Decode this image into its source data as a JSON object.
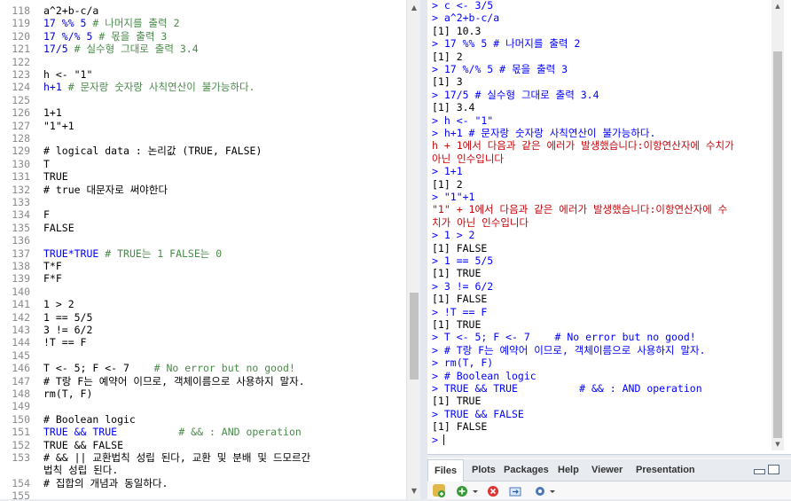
{
  "editor": {
    "lines": [
      {
        "n": "118",
        "t": "a^2+b-c/a",
        "c": "plain"
      },
      {
        "n": "119",
        "t": "17 %% 5 # 나머지를 출력 2",
        "c": "mix1"
      },
      {
        "n": "120",
        "t": "17 %/% 5 # 몫을 출력 3",
        "c": "mix1"
      },
      {
        "n": "121",
        "t": "17/5 # 실수형 그대로 출력 3.4",
        "c": "mix1"
      },
      {
        "n": "122",
        "t": "",
        "c": "plain"
      },
      {
        "n": "123",
        "t": "h <- \"1\"",
        "c": "plain"
      },
      {
        "n": "124",
        "t": "h+1 # 문자랑 숫자랑 사칙연산이 불가능하다.",
        "c": "mix1"
      },
      {
        "n": "125",
        "t": "",
        "c": "plain"
      },
      {
        "n": "126",
        "t": "1+1",
        "c": "num"
      },
      {
        "n": "127",
        "t": "\"1\"+1",
        "c": "plain"
      },
      {
        "n": "128",
        "t": "",
        "c": "plain"
      },
      {
        "n": "129",
        "t": "# logical data : 논리값 (TRUE, FALSE)",
        "c": "cmt"
      },
      {
        "n": "130",
        "t": "T",
        "c": "kw"
      },
      {
        "n": "131",
        "t": "TRUE",
        "c": "kw"
      },
      {
        "n": "132",
        "t": "# true 대문자로 써야한다",
        "c": "cmt"
      },
      {
        "n": "133",
        "t": "",
        "c": "plain"
      },
      {
        "n": "134",
        "t": "F",
        "c": "kw"
      },
      {
        "n": "135",
        "t": "FALSE",
        "c": "kw"
      },
      {
        "n": "136",
        "t": "",
        "c": "plain"
      },
      {
        "n": "137",
        "t": "TRUE*TRUE # TRUE는 1 FALSE는 0",
        "c": "mix2"
      },
      {
        "n": "138",
        "t": "T*F",
        "c": "kw"
      },
      {
        "n": "139",
        "t": "F*F",
        "c": "kw"
      },
      {
        "n": "140",
        "t": "",
        "c": "plain"
      },
      {
        "n": "141",
        "t": "1 > 2",
        "c": "num"
      },
      {
        "n": "142",
        "t": "1 == 5/5",
        "c": "num"
      },
      {
        "n": "143",
        "t": "3 != 6/2",
        "c": "num"
      },
      {
        "n": "144",
        "t": "!T == F",
        "c": "kw"
      },
      {
        "n": "145",
        "t": "",
        "c": "plain"
      },
      {
        "n": "146",
        "t": "T <- 5; F <- 7    # No error but no good!",
        "c": "mix3"
      },
      {
        "n": "147",
        "t": "# T랑 F는 예약어 이므로, 객체이름으로 사용하지 말자.",
        "c": "cmt"
      },
      {
        "n": "148",
        "t": "rm(T, F)",
        "c": "plain"
      },
      {
        "n": "149",
        "t": "",
        "c": "plain"
      },
      {
        "n": "150",
        "t": "# Boolean logic",
        "c": "cmt"
      },
      {
        "n": "151",
        "t": "TRUE && TRUE          # && : AND operation",
        "c": "mix4"
      },
      {
        "n": "152",
        "t": "TRUE && FALSE",
        "c": "kw"
      },
      {
        "n": "153",
        "t": "# && || 교환법칙 성립 된다, 교환 및 분배 및 드모르간",
        "c": "cmt"
      },
      {
        "n": "",
        "t": "법칙 성립 된다.",
        "c": "cmt"
      },
      {
        "n": "154",
        "t": "# 집합의 개념과 동일하다.",
        "c": "cmt"
      },
      {
        "n": "155",
        "t": "",
        "c": "plain"
      }
    ]
  },
  "console": {
    "lines": [
      {
        "t": "> c <- 3/5",
        "k": "in"
      },
      {
        "t": "> a^2+b-c/a",
        "k": "in"
      },
      {
        "t": "[1] 10.3",
        "k": "out"
      },
      {
        "t": "> 17 %% 5 # 나머지를 출력 2",
        "k": "in"
      },
      {
        "t": "[1] 2",
        "k": "out"
      },
      {
        "t": "> 17 %/% 5 # 몫을 출력 3",
        "k": "in"
      },
      {
        "t": "[1] 3",
        "k": "out"
      },
      {
        "t": "> 17/5 # 실수형 그대로 출력 3.4",
        "k": "in"
      },
      {
        "t": "[1] 3.4",
        "k": "out"
      },
      {
        "t": "> h <- \"1\"",
        "k": "in"
      },
      {
        "t": "> h+1 # 문자랑 숫자랑 사칙연산이 불가능하다.",
        "k": "in"
      },
      {
        "t": "h + 1에서 다음과 같은 에러가 발생했습니다:이항연산자에 수치가",
        "k": "err"
      },
      {
        "t": "아닌 인수입니다",
        "k": "err"
      },
      {
        "t": "> 1+1",
        "k": "in"
      },
      {
        "t": "[1] 2",
        "k": "out"
      },
      {
        "t": "> \"1\"+1",
        "k": "in"
      },
      {
        "t": "\"1\" + 1에서 다음과 같은 에러가 발생했습니다:이항연산자에 수",
        "k": "err"
      },
      {
        "t": "치가 아닌 인수입니다",
        "k": "err"
      },
      {
        "t": "> 1 > 2",
        "k": "in"
      },
      {
        "t": "[1] FALSE",
        "k": "out"
      },
      {
        "t": "> 1 == 5/5",
        "k": "in"
      },
      {
        "t": "[1] TRUE",
        "k": "out"
      },
      {
        "t": "> 3 != 6/2",
        "k": "in"
      },
      {
        "t": "[1] FALSE",
        "k": "out"
      },
      {
        "t": "> !T == F",
        "k": "in"
      },
      {
        "t": "[1] TRUE",
        "k": "out"
      },
      {
        "t": "> T <- 5; F <- 7    # No error but no good!",
        "k": "in"
      },
      {
        "t": "> # T랑 F는 예약어 이므로, 객체이름으로 사용하지 말자.",
        "k": "in"
      },
      {
        "t": "> rm(T, F)",
        "k": "in"
      },
      {
        "t": "> # Boolean logic",
        "k": "in"
      },
      {
        "t": "> TRUE && TRUE          # && : AND operation",
        "k": "in"
      },
      {
        "t": "[1] TRUE",
        "k": "out"
      },
      {
        "t": "> TRUE && FALSE",
        "k": "in"
      },
      {
        "t": "[1] FALSE",
        "k": "out"
      },
      {
        "t": ">",
        "k": "prompt"
      }
    ]
  },
  "files_pane": {
    "tabs": [
      "Files",
      "Plots",
      "Packages",
      "Help",
      "Viewer",
      "Presentation"
    ],
    "active_tab": "Files"
  },
  "colors": {
    "comment": "#4a8a4a",
    "keyword": "#0000ff",
    "number": "#0000cd",
    "console_input": "#0000ff",
    "console_error": "#c5060b"
  },
  "icons": {
    "toolbar": [
      "new-folder-icon",
      "add-icon",
      "dropdown-icon",
      "delete-icon",
      "rename-icon",
      "gear-icon",
      "dropdown-icon"
    ],
    "window": [
      "minimize-icon",
      "maximize-icon"
    ]
  }
}
